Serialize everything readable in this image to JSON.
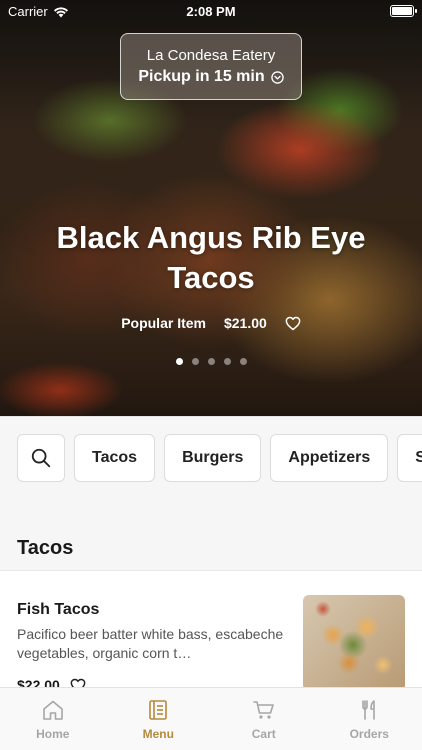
{
  "status": {
    "carrier": "Carrier",
    "time": "2:08 PM"
  },
  "store": {
    "name": "La Condesa Eatery",
    "pickup": "Pickup in 15 min"
  },
  "featured": {
    "title": "Black Angus Rib Eye Tacos",
    "tag": "Popular Item",
    "price": "$21.00",
    "page_count": 5,
    "active_page": 1
  },
  "categories": [
    "Tacos",
    "Burgers",
    "Appetizers",
    "S"
  ],
  "section": {
    "title": "Tacos"
  },
  "item": {
    "name": "Fish Tacos",
    "description": "Pacifico beer batter white bass, escabeche vegetables, organic corn t…",
    "price": "$22.00"
  },
  "tabs": [
    {
      "label": "Home",
      "icon": "home-icon",
      "active": false
    },
    {
      "label": "Menu",
      "icon": "menu-book-icon",
      "active": true
    },
    {
      "label": "Cart",
      "icon": "cart-icon",
      "active": false
    },
    {
      "label": "Orders",
      "icon": "utensils-icon",
      "active": false
    }
  ],
  "colors": {
    "accent": "#b58a3c",
    "inactive": "#a6a6a6"
  }
}
